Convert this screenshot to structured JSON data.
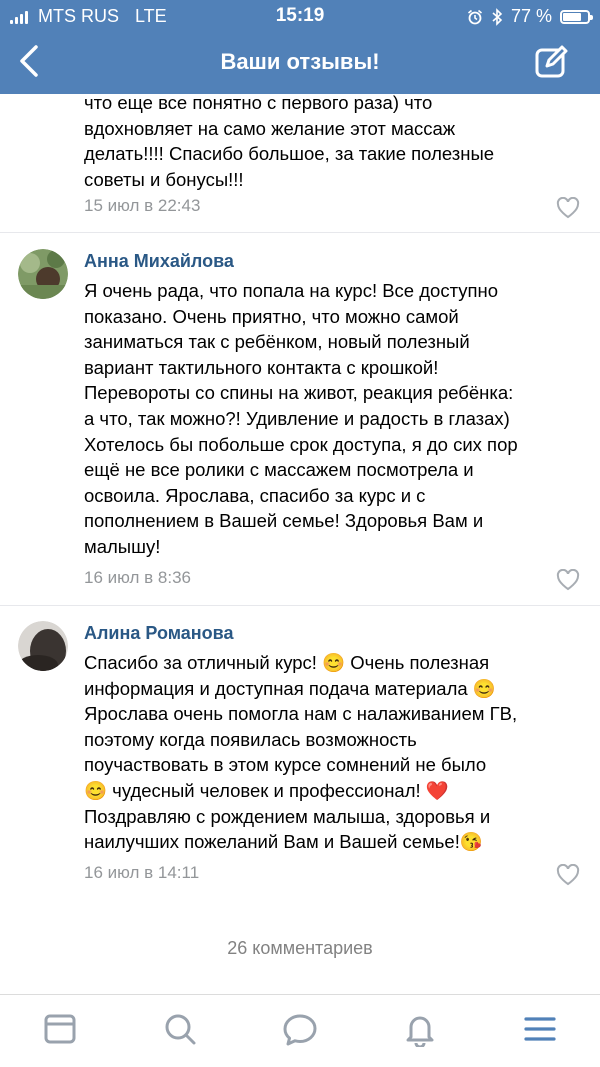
{
  "status_bar": {
    "carrier": "MTS RUS",
    "network": "LTE",
    "time": "15:19",
    "battery_percent": "77 %",
    "battery_level": 0.77
  },
  "nav": {
    "title": "Ваши отзывы!",
    "back_icon": "chevron-left-icon",
    "edit_icon": "compose-icon"
  },
  "comments": [
    {
      "text": "что еще все понятно с первого раза) что\nвдохновляет на само желание этот массаж\nделать!!!! Спасибо большое, за такие полезные\nсоветы и бонусы!!!",
      "date": "15 июл в 22:43"
    },
    {
      "name": "Анна Михайлова",
      "text": "Я очень рада, что попала на курс! Все доступно\nпоказано. Очень приятно, что можно самой\nзаниматься так с ребёнком, новый полезный\nвариант тактильного контакта с крошкой!\nПеревороты со спины на живот, реакция ребёнка:\nа что, так можно?! Удивление и радость в глазах)\nХотелось бы побольше срок доступа, я до сих пор\nещё не все ролики с массажем посмотрела и\nосвоила. Ярослава, спасибо за курс и с\nпополнением в Вашей семье! Здоровья Вам и\nмалышу!",
      "date": "16 июл в 8:36"
    },
    {
      "name": "Алина Романова",
      "text": "Спасибо за отличный курс! 😊 Очень полезная\nинформация и доступная подача материала 😊\nЯрослава очень помогла нам с налаживанием ГВ,\nпоэтому когда появилась возможность\nпоучаствовать в этом курсе сомнений не было\n😊 чудесный человек и профессионал! ❤️\nПоздравляю с рождением малыша, здоровья и\nнаилучших пожеланий Вам и Вашей семье!😘",
      "date": "16 июл в 14:11"
    }
  ],
  "comments_count": "26 комментариев",
  "tabbar": [
    "news-icon",
    "search-icon",
    "messages-icon",
    "notifications-icon",
    "menu-icon"
  ],
  "colors": {
    "header": "#5181b8",
    "name": "#2a5885",
    "date": "#939699",
    "tab_icon": "#99a2ad",
    "tab_active": "#5181b8"
  }
}
